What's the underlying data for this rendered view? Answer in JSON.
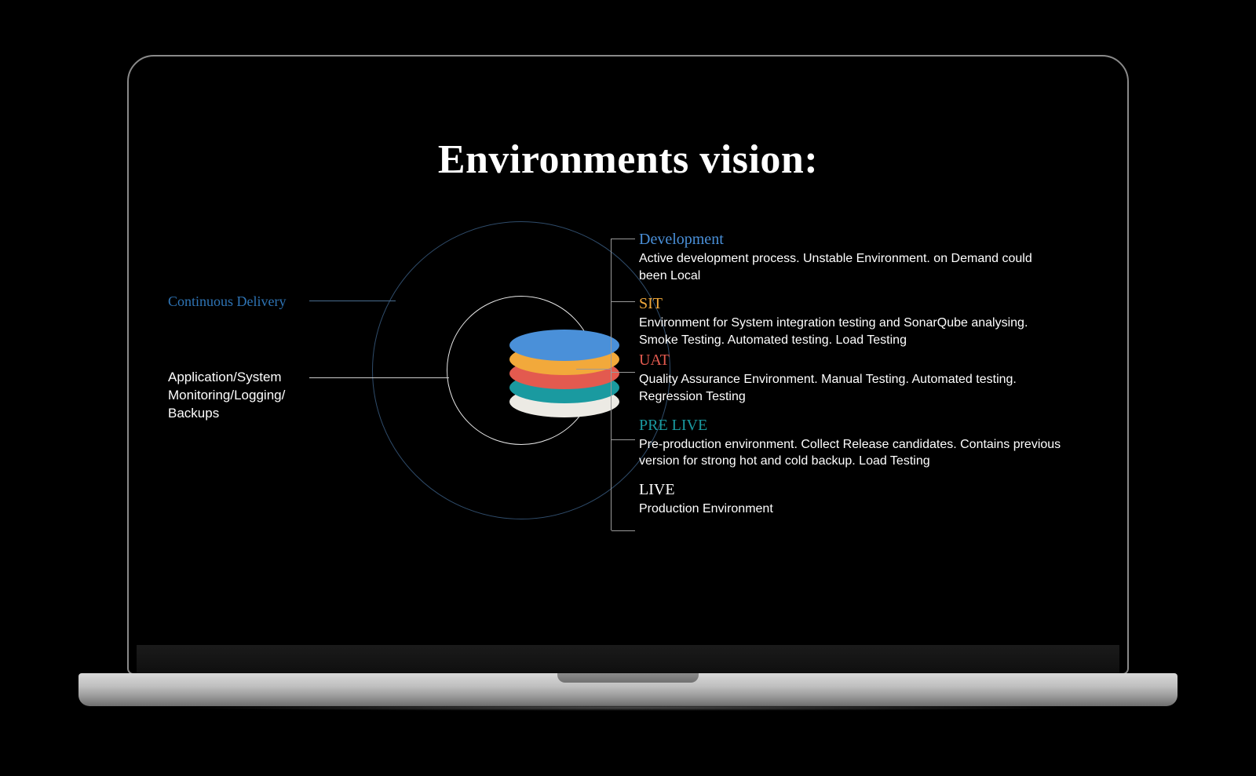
{
  "title": "Environments vision:",
  "left": {
    "continuous_delivery": "Continuous Delivery",
    "monitoring": "Application/System Monitoring/Logging/ Backups"
  },
  "environments": {
    "dev": {
      "name": "Development",
      "desc": "Active development process. Unstable Environment. on Demand could been Local"
    },
    "sit": {
      "name": "SIT",
      "desc": "Environment for System integration testing and SonarQube analysing. Smoke Testing. Automated testing. Load Testing"
    },
    "uat": {
      "name": "UAT",
      "desc": "Quality Assurance Environment. Manual Testing. Automated testing. Regression Testing"
    },
    "pre": {
      "name": "PRE LIVE",
      "desc": "Pre-production environment. Collect Release candidates. Contains previous version for strong hot and cold backup. Load Testing"
    },
    "live": {
      "name": "LIVE",
      "desc": "Production Environment"
    }
  },
  "colors": {
    "dev": "#4a90d9",
    "sit": "#f2a93b",
    "uat": "#e35a4f",
    "pre": "#1a9aa0",
    "live": "#eceae4"
  }
}
